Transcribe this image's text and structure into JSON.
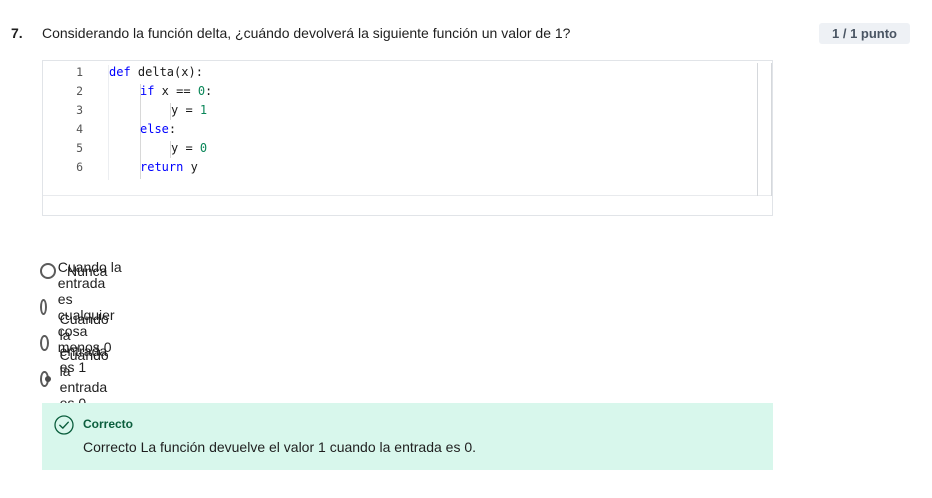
{
  "question": {
    "number": "7.",
    "text": "Considerando la función delta, ¿cuándo devolverá la siguiente función un valor de 1?",
    "points": "1 / 1 punto"
  },
  "code": {
    "line_numbers": [
      "1",
      "2",
      "3",
      "4",
      "5",
      "6"
    ],
    "lines": [
      "def delta(x):",
      "if x == 0:",
      "y = 1",
      "else:",
      "y = 0",
      "return y"
    ]
  },
  "options": [
    {
      "label": "Nunca",
      "selected": false
    },
    {
      "label": "Cuando la entrada es cualquier cosa menos 0",
      "selected": false
    },
    {
      "label": "Cuando la entrada es 1",
      "selected": false
    },
    {
      "label": "Cuando la entrada es 0",
      "selected": true
    }
  ],
  "feedback": {
    "title": "Correcto",
    "text": "Correcto La función devuelve el valor 1 cuando la entrada es 0."
  },
  "colors": {
    "feedback_bg": "#d8f7ec",
    "feedback_accent": "#0b5e3d",
    "keyword": "#0000ff",
    "number": "#098658"
  }
}
